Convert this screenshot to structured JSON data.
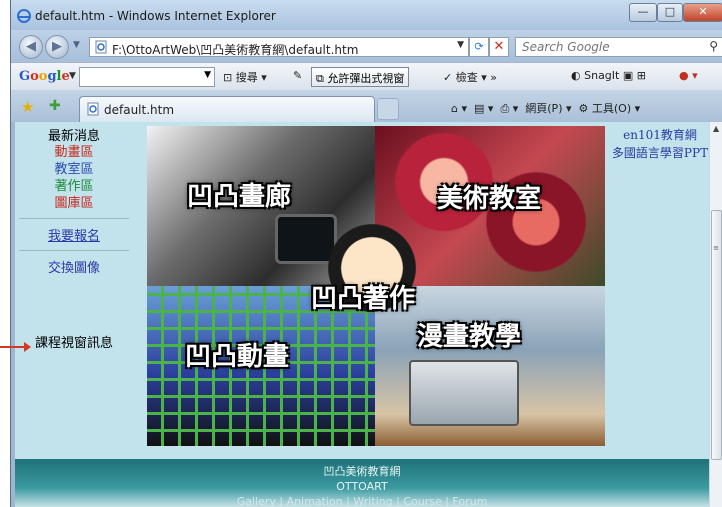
{
  "window": {
    "title": "default.htm - Windows Internet Explorer",
    "min_label": "—",
    "max_label": "□",
    "close_label": "✕"
  },
  "address": {
    "url": "F:\\OttoArtWeb\\凹凸美術教育網\\default.htm",
    "search_placeholder": "Search Google"
  },
  "google_toolbar": {
    "search_label": "搜尋",
    "popup_label": "允許彈出式視窗",
    "spell_label": "檢查",
    "snagit_label": "SnagIt"
  },
  "tab": {
    "title": "default.htm",
    "page_menu": "網頁(P)",
    "tools_menu": "工具(O)"
  },
  "left_nav": {
    "heading": "最新消息",
    "items": [
      {
        "label": "動畫區",
        "color": "#c8281c"
      },
      {
        "label": "教室區",
        "color": "#2a4db0"
      },
      {
        "label": "著作區",
        "color": "#1d8b3a"
      },
      {
        "label": "圖庫區",
        "color": "#c8281c"
      }
    ],
    "signup": "我要報名",
    "exchange": "交換圖像",
    "course_info": "課程視窗訊息"
  },
  "banner": {
    "gallery": "凹凸畫廊",
    "classroom": "美術教室",
    "works": "凹凸著作",
    "animation": "凹凸動畫",
    "comics": "漫畫教學"
  },
  "right_nav": {
    "link1": "en101教育網",
    "link2": "多國語言學習PPT"
  },
  "footer": {
    "line1": "凹凸美術教育網",
    "line2": "OTTOART",
    "line3": "Gallery | Animation | Writing | Course | Forum"
  },
  "colors": {
    "content_bg": "#c2e2ec",
    "footer_teal": "#1f7278",
    "link_blue": "#2a3aa8"
  }
}
